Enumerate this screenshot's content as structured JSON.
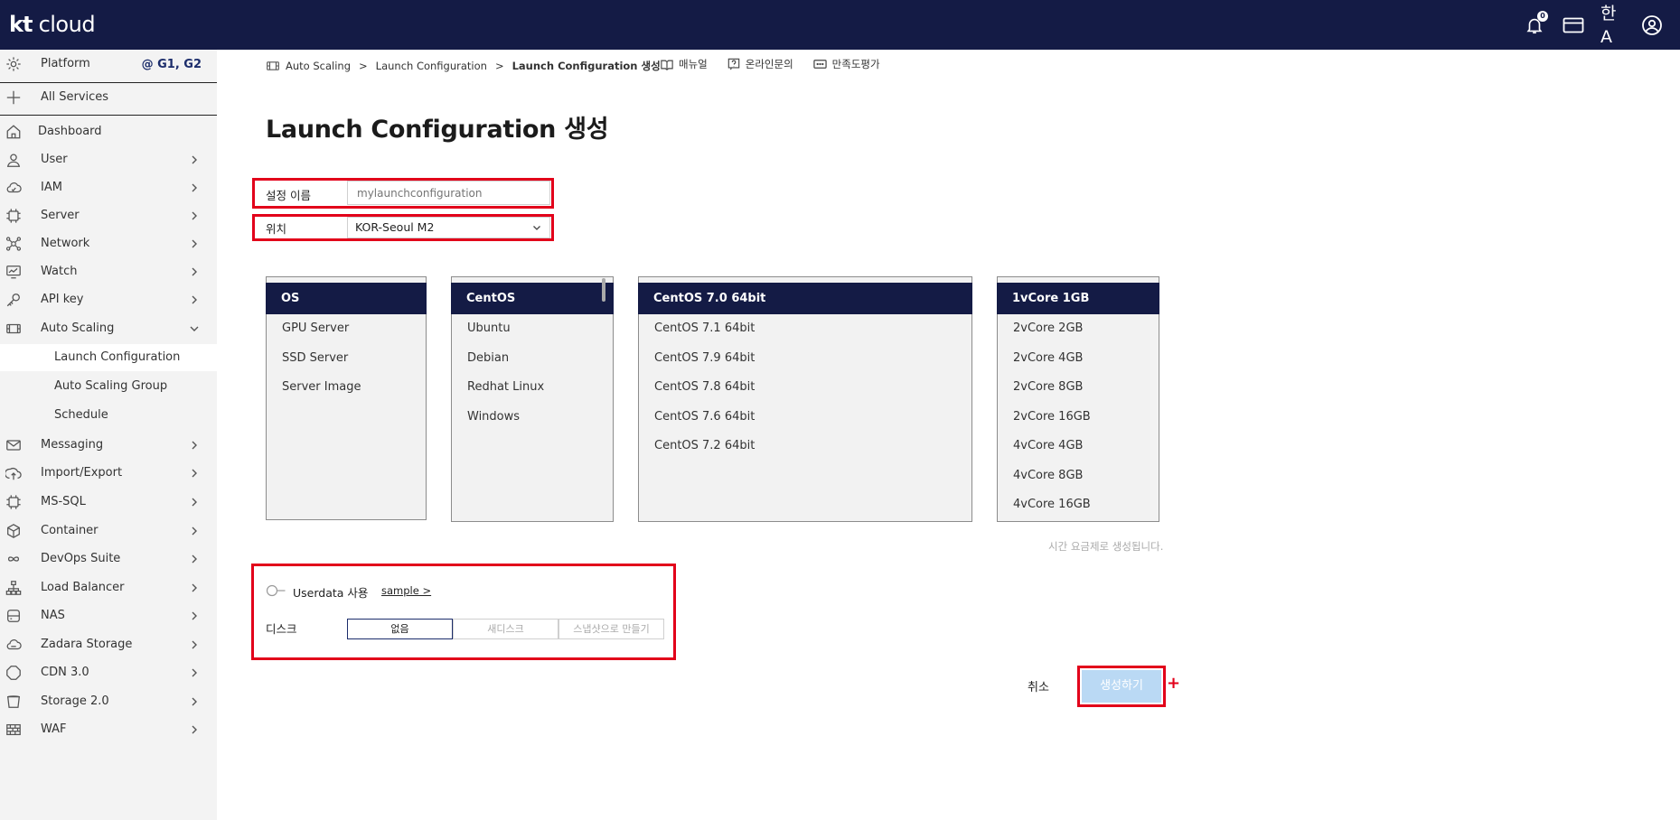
{
  "header": {
    "logo_bold": "kt",
    "logo_text": " cloud",
    "notification_count": "0",
    "lang_glyph": "한A"
  },
  "sidebar": {
    "platform": {
      "label": "Platform",
      "tag": "@ G1, G2"
    },
    "all_services": "All Services",
    "dashboard": "Dashboard",
    "items": [
      {
        "label": "User",
        "icon": "user-icon"
      },
      {
        "label": "IAM",
        "icon": "iam-icon"
      },
      {
        "label": "Server",
        "icon": "server-icon"
      },
      {
        "label": "Network",
        "icon": "network-icon"
      },
      {
        "label": "Watch",
        "icon": "watch-icon"
      },
      {
        "label": "API key",
        "icon": "key-icon"
      },
      {
        "label": "Auto Scaling",
        "icon": "autoscaling-icon"
      }
    ],
    "sub_items": [
      {
        "label": "Launch Configuration",
        "active": true
      },
      {
        "label": "Auto Scaling Group",
        "active": false
      },
      {
        "label": "Schedule",
        "active": false
      }
    ],
    "items_after": [
      {
        "label": "Messaging",
        "icon": "mail-icon"
      },
      {
        "label": "Import/Export",
        "icon": "import-export-icon"
      },
      {
        "label": "MS-SQL",
        "icon": "database-chip-icon"
      },
      {
        "label": "Container",
        "icon": "container-icon"
      },
      {
        "label": "DevOps Suite",
        "icon": "infinity-icon"
      },
      {
        "label": "Load Balancer",
        "icon": "load-balancer-icon"
      },
      {
        "label": "NAS",
        "icon": "nas-icon"
      },
      {
        "label": "Zadara Storage",
        "icon": "cloud-storage-icon"
      },
      {
        "label": "CDN 3.0",
        "icon": "cdn-icon"
      },
      {
        "label": "Storage 2.0",
        "icon": "bucket-icon"
      },
      {
        "label": "WAF",
        "icon": "waf-icon"
      }
    ]
  },
  "breadcrumb": {
    "items": [
      "Auto Scaling",
      "Launch Configuration"
    ],
    "current": "Launch Configuration 생성",
    "separator": ">"
  },
  "toplinks": {
    "manual": "매뉴얼",
    "inquiry": "온라인문의",
    "survey": "만족도평가"
  },
  "page": {
    "title": "Launch Configuration 생성"
  },
  "form": {
    "name_label": "설정 이름",
    "name_placeholder": "mylaunchconfiguration",
    "location_label": "위치",
    "location_value": "KOR-Seoul M2"
  },
  "lists": {
    "category": {
      "selected": "OS",
      "items": [
        "GPU Server",
        "SSD Server",
        "Server Image"
      ]
    },
    "os": {
      "selected": "CentOS",
      "items": [
        "Ubuntu",
        "Debian",
        "Redhat Linux",
        "Windows"
      ]
    },
    "version": {
      "selected": "CentOS 7.0 64bit",
      "items": [
        "CentOS 7.1 64bit",
        "CentOS 7.9 64bit",
        "CentOS 7.8 64bit",
        "CentOS 7.6 64bit",
        "CentOS 7.2 64bit"
      ]
    },
    "spec": {
      "selected": "1vCore 1GB",
      "items": [
        "2vCore 2GB",
        "2vCore 4GB",
        "2vCore 8GB",
        "2vCore 16GB",
        "4vCore 4GB",
        "4vCore 8GB",
        "4vCore 16GB"
      ]
    }
  },
  "note": "시간 요금제로 생성됩니다.",
  "userdata": {
    "label": "Userdata 사용",
    "link": "sample >"
  },
  "disk": {
    "label": "디스크",
    "options": [
      "없음",
      "새디스크",
      "스냅샷으로 만들기"
    ],
    "selected": "없음"
  },
  "actions": {
    "cancel": "취소",
    "create": "생성하기",
    "plus": "+"
  },
  "colors": {
    "header_bg": "#141b45",
    "list_selected_bg": "#141b45",
    "annotation_red": "#e2001a",
    "create_button_bg": "#bad9f4"
  }
}
